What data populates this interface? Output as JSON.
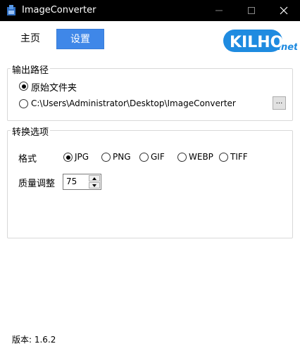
{
  "window": {
    "title": "ImageConverter"
  },
  "nav": {
    "home_label": "主页",
    "settings_label": "设置",
    "active": "settings"
  },
  "logo": {
    "text_main": "KILHO",
    "text_suffix": ".net",
    "color": "#1f8be0"
  },
  "output_path": {
    "group_title": "输出路径",
    "options": [
      {
        "label": "原始文件夹",
        "checked": true
      },
      {
        "label": "C:\\Users\\Administrator\\Desktop\\ImageConverter",
        "checked": false
      }
    ],
    "browse_label": "..."
  },
  "convert": {
    "group_title": "转换选项",
    "format_label": "格式",
    "formats": [
      {
        "label": "JPG",
        "checked": true
      },
      {
        "label": "PNG",
        "checked": false
      },
      {
        "label": "GIF",
        "checked": false
      },
      {
        "label": "WEBP",
        "checked": false
      },
      {
        "label": "TIFF",
        "checked": false
      }
    ],
    "quality_label": "质量调整",
    "quality_value": "75"
  },
  "footer": {
    "version": "版本: 1.6.2"
  },
  "colors": {
    "accent": "#3f87e8",
    "titlebar": "#000000"
  }
}
